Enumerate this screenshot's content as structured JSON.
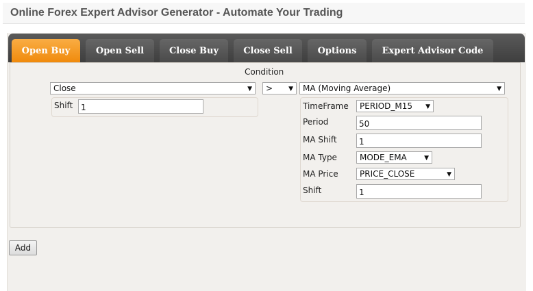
{
  "header": {
    "title": "Online Forex Expert Advisor Generator - Automate Your Trading"
  },
  "tabs": [
    {
      "label": "Open Buy",
      "active": true
    },
    {
      "label": "Open Sell",
      "active": false
    },
    {
      "label": "Close Buy",
      "active": false
    },
    {
      "label": "Close Sell",
      "active": false
    },
    {
      "label": "Options",
      "active": false
    },
    {
      "label": "Expert Advisor Code",
      "active": false
    }
  ],
  "condition": {
    "label": "Condition",
    "left_indicator": "Close",
    "operator": ">",
    "right_indicator": "MA (Moving Average)",
    "left_params": {
      "shift_label": "Shift",
      "shift_value": "1"
    },
    "right_params": {
      "timeframe_label": "TimeFrame",
      "timeframe_value": "PERIOD_M15",
      "period_label": "Period",
      "period_value": "50",
      "ma_shift_label": "MA Shift",
      "ma_shift_value": "1",
      "ma_type_label": "MA Type",
      "ma_type_value": "MODE_EMA",
      "ma_price_label": "MA Price",
      "ma_price_value": "PRICE_CLOSE",
      "shift_label": "Shift",
      "shift_value": "1"
    }
  },
  "actions": {
    "add_label": "Add"
  },
  "colors": {
    "active_tab": "#f08a0c",
    "tab_bar": "#3e3e3e",
    "panel_bg": "#f2f0ed"
  },
  "icons": {
    "dropdown": "triangle-down-icon"
  }
}
